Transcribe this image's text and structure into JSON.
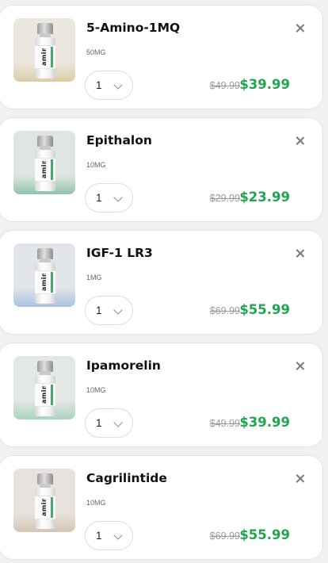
{
  "cart_items": [
    {
      "name": "5-Amino-1MQ",
      "dose": "50MG",
      "quantity": "1",
      "old_price": "$49.99",
      "price": "$39.99",
      "image_bg": "#ebe6de",
      "image_ground": "#dccda3",
      "vial_brand": "amino"
    },
    {
      "name": "Epithalon",
      "dose": "10MG",
      "quantity": "1",
      "old_price": "$29.99",
      "price": "$23.99",
      "image_bg": "#dfe6e1",
      "image_ground": "#8fc3a9",
      "vial_brand": "amino"
    },
    {
      "name": "IGF-1 LR3",
      "dose": "1MG",
      "quantity": "1",
      "old_price": "$69.99",
      "price": "$55.99",
      "image_bg": "#e2e5ea",
      "image_ground": "#a9c2dd",
      "vial_brand": "amino"
    },
    {
      "name": "Ipamorelin",
      "dose": "10MG",
      "quantity": "1",
      "old_price": "$49.99",
      "price": "$39.99",
      "image_bg": "#e2e8e3",
      "image_ground": "#a8d3c0",
      "vial_brand": "amino"
    },
    {
      "name": "Cagrilintide",
      "dose": "10MG",
      "quantity": "1",
      "old_price": "$69.99",
      "price": "$55.99",
      "image_bg": "#e7e2dc",
      "image_ground": "#d6c5b5",
      "vial_brand": "amino"
    }
  ],
  "icons": {
    "remove": "close-icon",
    "quantity_dropdown": "chevron-down-icon"
  },
  "colors": {
    "sale_price": "#1fa64f",
    "old_price": "#9a9a9a",
    "card_bg": "#ffffff",
    "page_bg": "#f1f1f1"
  }
}
